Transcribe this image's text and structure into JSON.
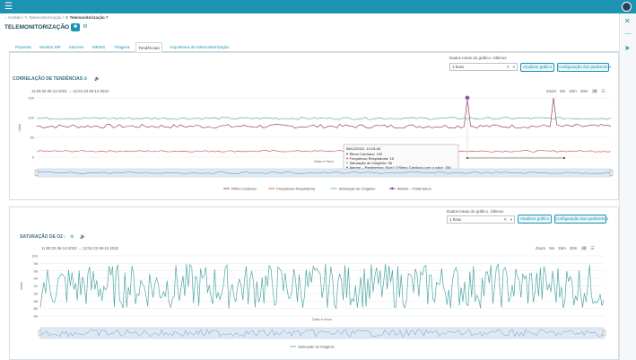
{
  "topbar": {
    "menu_icon": "hamburger-icon",
    "avatar_icon": "user-avatar-icon"
  },
  "breadcrumb": {
    "home": "Gestão",
    "middle": "Telemonitorização",
    "current": "Telemonitorização 7"
  },
  "page": {
    "title": "TELEMONITORIZAÇÃO"
  },
  "tabs": [
    "Paciente",
    "Monitor MP",
    "Alarmes",
    "MEWS",
    "Triagens",
    "Tendências",
    "Arquitetura de telemonitorização"
  ],
  "active_tab": "Tendências",
  "panel1": {
    "data_label": "Dados totais do gráfico. Últimos",
    "select_value": "1 hora",
    "btn_update": "Atualizar gráfico",
    "btn_config": "Configuração dos parâmetros",
    "section_title": "CORRELAÇÃO DE TENDÊNCIAS",
    "range_from": "11:00:32 06-12-2022",
    "range_sep": "→",
    "range_to": "12:51:23 06-12-2022",
    "zoom_label": "Zoom",
    "zoom_options": [
      "5m",
      "10m",
      "30m",
      "All"
    ]
  },
  "panel2": {
    "data_label": "Dados totais do gráfico. Últimos",
    "select_value": "1 hora",
    "btn_update": "Atualizar gráfico",
    "btn_config": "Configuração dos parâmetros",
    "section_title": "SATURAÇÃO DE O2",
    "range_from": "11:50:32 06-12-2022",
    "range_sep": "→",
    "range_to": "12:51:23 06-12-2022",
    "zoom_label": "Zoom",
    "zoom_options": [
      "5m",
      "15m",
      "30m",
      "All"
    ]
  },
  "chart_data": [
    {
      "type": "line",
      "title": "CORRELAÇÃO DE TENDÊNCIAS",
      "xlabel": "Data e Hora",
      "ylabel": "Valor",
      "ylim": [
        0,
        150
      ],
      "yticks": [
        0,
        50,
        100,
        150
      ],
      "grid": true,
      "legend_position": "bottom",
      "series": [
        {
          "name": "Ritmo Cardíaco",
          "color": "#8b2442",
          "base": 78,
          "amp": 5,
          "spike_value": 150
        },
        {
          "name": "Frequência Respiratória",
          "color": "#e23b3b",
          "base": 15,
          "amp": 2
        },
        {
          "name": "Saturação de Oxigénio",
          "color": "#4fa7a5",
          "base": 98,
          "amp": 3
        },
        {
          "name": "Alarme – Parâmetros",
          "color": "#6b3fa0",
          "marker": true
        }
      ],
      "tooltip": {
        "datetime": "06/12/2022, 12:15:48",
        "lines": [
          "Ritmo Cardíaco: 150",
          "Frequência Respiratória: 15",
          "Saturação de Oxigénio: 98",
          "Alarme – Parâmetros: Nível: 3 Ritmo Cardíaco com o valor: 150"
        ]
      }
    },
    {
      "type": "line",
      "title": "SATURAÇÃO DE O2",
      "xlabel": "Data e Hora",
      "ylabel": "Valor",
      "ylim": [
        84,
        100
      ],
      "yticks": [
        84,
        86,
        88,
        90,
        92,
        94,
        96,
        98,
        100
      ],
      "grid": true,
      "legend_position": "bottom",
      "series": [
        {
          "name": "Saturação de Oxigénio",
          "color": "#4fa7a5",
          "range": [
            86,
            98
          ]
        }
      ]
    }
  ]
}
